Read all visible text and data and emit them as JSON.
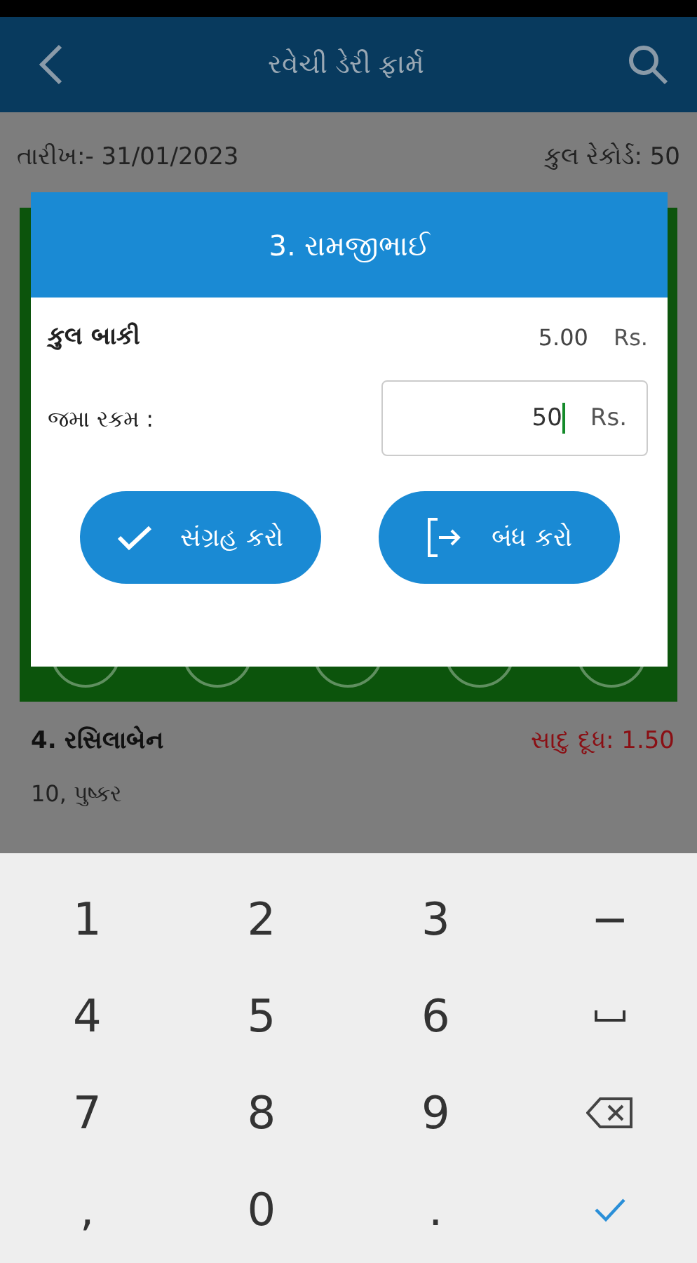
{
  "app_bar": {
    "title": "રવેચી ડેરી ફાર્મ"
  },
  "summary": {
    "date": "તારીખ:- 31/01/2023",
    "total_records": "કુલ રેકોર્ડ: 50"
  },
  "entries": [
    {
      "name": "4. રસિલાબેન",
      "milk": "સાદુ દૂધ: 1.50",
      "address": "10, પુષ્કર"
    }
  ],
  "dialog": {
    "title": "3. રામજીભાઈ",
    "balance_label": "કુલ બાકી",
    "balance": "5.00",
    "balance_unit": "Rs.",
    "deposit_label": "જમા રકમ :",
    "deposit_value": "50",
    "deposit_unit": "Rs.",
    "buttons": [
      {
        "kind": "save",
        "label": "સંગ્રહ કરો"
      },
      {
        "kind": "close",
        "label": "બંધ કરો"
      }
    ]
  },
  "keyboard": {
    "keys": [
      {
        "kind": "text",
        "label": "1"
      },
      {
        "kind": "text",
        "label": "2"
      },
      {
        "kind": "text",
        "label": "3"
      },
      {
        "kind": "text",
        "label": "−"
      },
      {
        "kind": "text",
        "label": "4"
      },
      {
        "kind": "text",
        "label": "5"
      },
      {
        "kind": "text",
        "label": "6"
      },
      {
        "kind": "space"
      },
      {
        "kind": "text",
        "label": "7"
      },
      {
        "kind": "text",
        "label": "8"
      },
      {
        "kind": "text",
        "label": "9"
      },
      {
        "kind": "backspace"
      },
      {
        "kind": "text",
        "label": ","
      },
      {
        "kind": "text",
        "label": "0"
      },
      {
        "kind": "text",
        "label": "."
      },
      {
        "kind": "done"
      }
    ]
  }
}
